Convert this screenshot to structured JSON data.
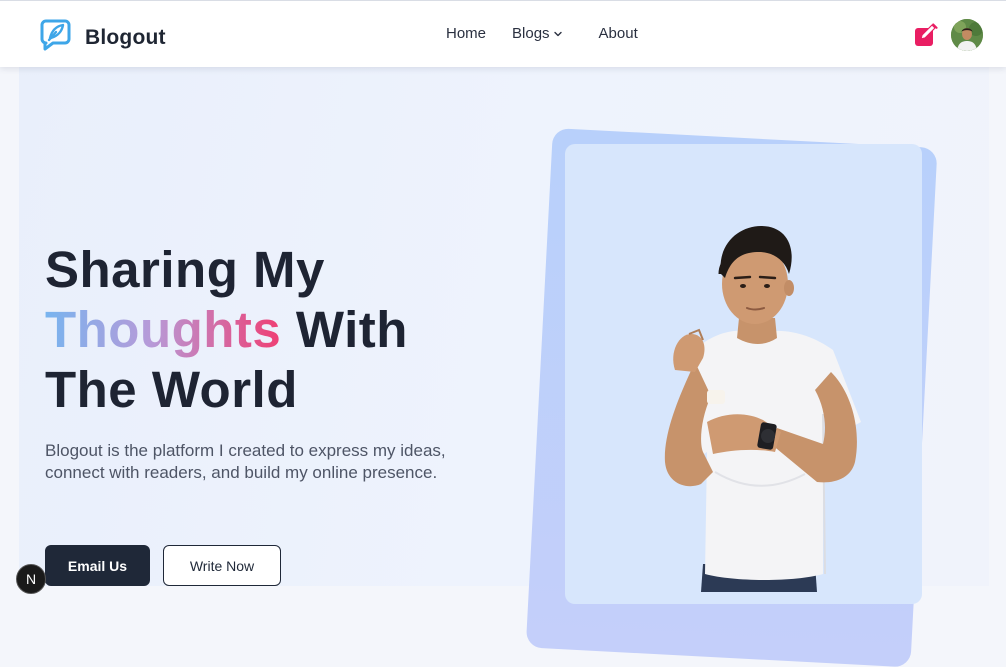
{
  "brand": {
    "name": "Blogout",
    "logo_icon": "feather-bubble-icon",
    "accent": "#3ea6e8"
  },
  "nav": {
    "items": [
      {
        "label": "Home"
      },
      {
        "label": "Blogs",
        "icon": "chevron-down-icon"
      },
      {
        "label": "About"
      }
    ]
  },
  "header_actions": {
    "write_icon": "edit-square-icon",
    "write_color": "#e91e63",
    "avatar": "user-avatar"
  },
  "hero": {
    "line1": "Sharing My",
    "line2_highlight": "Thoughts",
    "line2_rest": " With",
    "line3": "The World",
    "description": "Blogout is the platform I created to express my ideas, connect with readers, and build my online presence.",
    "primary_cta": "Email Us",
    "secondary_cta": "Write Now",
    "gradient_colors": [
      "#78b4ef",
      "#b79ad8",
      "#ef3f74"
    ]
  },
  "dev_badge": {
    "label": "N"
  }
}
